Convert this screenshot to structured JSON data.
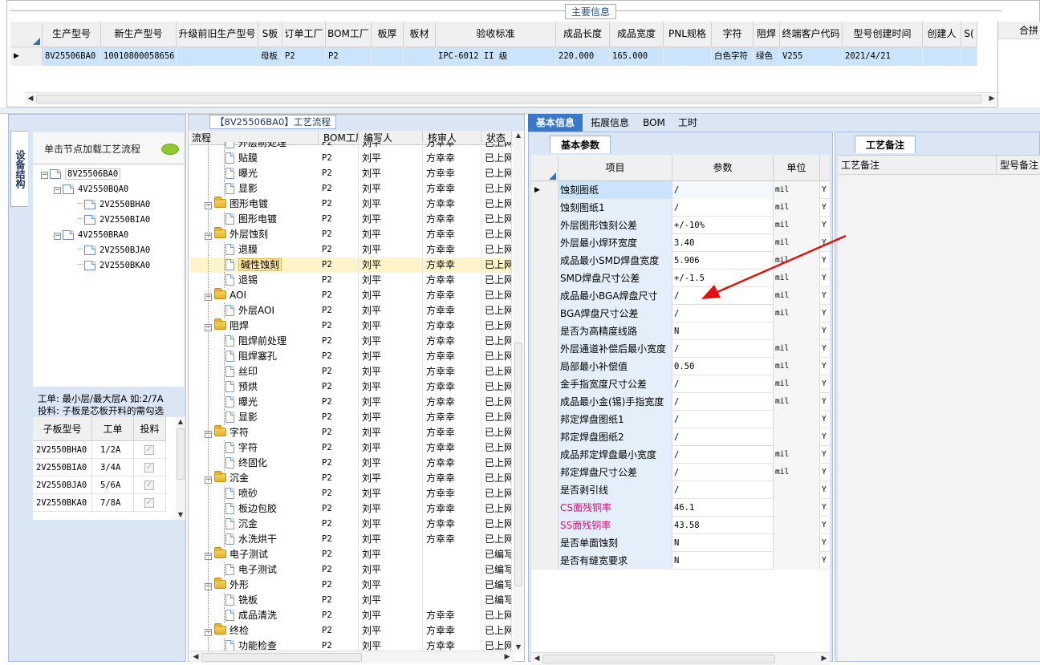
{
  "top": {
    "section_title": "主要信息",
    "columns": [
      "生产型号",
      "新生产型号",
      "升级前旧生产型号",
      "S板",
      "订单工厂",
      "BOM工厂",
      "板厚",
      "板材",
      "验收标准",
      "成品长度",
      "成品宽度",
      "PNL规格",
      "字符",
      "阻焊",
      "终端客户代码",
      "型号创建时间",
      "创建人",
      "S("
    ],
    "row": [
      "8V25506BA0",
      "10010800058656",
      "",
      "母板",
      "P2",
      "P2",
      "",
      "",
      "IPC-6012 II 级",
      "220.000",
      "165.000",
      "",
      "白色字符",
      "绿色",
      "V255",
      "2021/4/21",
      "",
      ""
    ],
    "right_header": "合拼"
  },
  "left": {
    "vtab": "设备结构",
    "header_text": "单击节点加载工艺流程",
    "tree": [
      {
        "label": "8V25506BA0",
        "level": 0
      },
      {
        "label": "4V2550BQA0",
        "level": 1
      },
      {
        "label": "2V2550BHA0",
        "level": 2
      },
      {
        "label": "2V2550BIA0",
        "level": 2
      },
      {
        "label": "4V2550BRA0",
        "level": 1
      },
      {
        "label": "2V2550BJA0",
        "level": 2
      },
      {
        "label": "2V2550BKA0",
        "level": 2
      }
    ],
    "note1": "工单: 最小层/最大层A 如:2/7A",
    "note2": "投料: 子板是芯板开料的需勾选",
    "table_headers": [
      "子板型号",
      "工单",
      "投料"
    ],
    "table_rows": [
      {
        "model": "2V2550BHA0",
        "order": "1/2A"
      },
      {
        "model": "2V2550BIA0",
        "order": "3/4A"
      },
      {
        "model": "2V2550BJA0",
        "order": "5/6A"
      },
      {
        "model": "2V2550BKA0",
        "order": "7/8A"
      }
    ]
  },
  "flow": {
    "title": "【8V25506BA0】工艺流程",
    "headers": [
      "流程",
      "BOM工厂",
      "编写人",
      "核审人",
      "状态"
    ],
    "rows": [
      {
        "t": "d",
        "name": "外层前处理",
        "bom": "P2",
        "w": "刘平",
        "r": "方幸幸",
        "s": "已上网"
      },
      {
        "t": "d",
        "name": "贴膜",
        "bom": "P2",
        "w": "刘平",
        "r": "方幸幸",
        "s": "已上网"
      },
      {
        "t": "d",
        "name": "曝光",
        "bom": "P2",
        "w": "刘平",
        "r": "方幸幸",
        "s": "已上网"
      },
      {
        "t": "d",
        "name": "显影",
        "bom": "P2",
        "w": "刘平",
        "r": "方幸幸",
        "s": "已上网"
      },
      {
        "t": "f",
        "name": "图形电镀",
        "bom": "P2",
        "w": "刘平",
        "r": "方幸幸",
        "s": "已上网"
      },
      {
        "t": "d",
        "name": "图形电镀",
        "bom": "P2",
        "w": "刘平",
        "r": "方幸幸",
        "s": "已上网"
      },
      {
        "t": "f",
        "name": "外层蚀刻",
        "bom": "P2",
        "w": "刘平",
        "r": "方幸幸",
        "s": "已上网"
      },
      {
        "t": "d",
        "name": "退膜",
        "bom": "P2",
        "w": "刘平",
        "r": "方幸幸",
        "s": "已上网"
      },
      {
        "t": "d",
        "name": "碱性蚀刻",
        "bom": "P2",
        "w": "刘平",
        "r": "方幸幸",
        "s": "已上网",
        "sel": true
      },
      {
        "t": "d",
        "name": "退锡",
        "bom": "P2",
        "w": "刘平",
        "r": "方幸幸",
        "s": "已上网"
      },
      {
        "t": "f",
        "name": "AOI",
        "bom": "P2",
        "w": "刘平",
        "r": "方幸幸",
        "s": "已上网"
      },
      {
        "t": "d",
        "name": "外层AOI",
        "bom": "P2",
        "w": "刘平",
        "r": "方幸幸",
        "s": "已上网"
      },
      {
        "t": "f",
        "name": "阻焊",
        "bom": "P2",
        "w": "刘平",
        "r": "方幸幸",
        "s": "已上网"
      },
      {
        "t": "d",
        "name": "阻焊前处理",
        "bom": "P2",
        "w": "刘平",
        "r": "方幸幸",
        "s": "已上网"
      },
      {
        "t": "d",
        "name": "阻焊塞孔",
        "bom": "P2",
        "w": "刘平",
        "r": "方幸幸",
        "s": "已上网"
      },
      {
        "t": "d",
        "name": "丝印",
        "bom": "P2",
        "w": "刘平",
        "r": "方幸幸",
        "s": "已上网"
      },
      {
        "t": "d",
        "name": "预烘",
        "bom": "P2",
        "w": "刘平",
        "r": "方幸幸",
        "s": "已上网"
      },
      {
        "t": "d",
        "name": "曝光",
        "bom": "P2",
        "w": "刘平",
        "r": "方幸幸",
        "s": "已上网"
      },
      {
        "t": "d",
        "name": "显影",
        "bom": "P2",
        "w": "刘平",
        "r": "方幸幸",
        "s": "已上网"
      },
      {
        "t": "f",
        "name": "字符",
        "bom": "P2",
        "w": "刘平",
        "r": "方幸幸",
        "s": "已上网"
      },
      {
        "t": "d",
        "name": "字符",
        "bom": "P2",
        "w": "刘平",
        "r": "方幸幸",
        "s": "已上网"
      },
      {
        "t": "d",
        "name": "终固化",
        "bom": "P2",
        "w": "刘平",
        "r": "方幸幸",
        "s": "已上网"
      },
      {
        "t": "f",
        "name": "沉金",
        "bom": "P2",
        "w": "刘平",
        "r": "方幸幸",
        "s": "已上网"
      },
      {
        "t": "d",
        "name": "喷砂",
        "bom": "P2",
        "w": "刘平",
        "r": "方幸幸",
        "s": "已上网"
      },
      {
        "t": "d",
        "name": "板边包胶",
        "bom": "P2",
        "w": "刘平",
        "r": "方幸幸",
        "s": "已上网"
      },
      {
        "t": "d",
        "name": "沉金",
        "bom": "P2",
        "w": "刘平",
        "r": "方幸幸",
        "s": "已上网"
      },
      {
        "t": "d",
        "name": "水洗烘干",
        "bom": "P2",
        "w": "刘平",
        "r": "方幸幸",
        "s": "已上网"
      },
      {
        "t": "f",
        "name": "电子测试",
        "bom": "P2",
        "w": "刘平",
        "r": "",
        "s": "已编写"
      },
      {
        "t": "d",
        "name": "电子测试",
        "bom": "P2",
        "w": "刘平",
        "r": "",
        "s": "已编写"
      },
      {
        "t": "f",
        "name": "外形",
        "bom": "P2",
        "w": "刘平",
        "r": "",
        "s": "已编写"
      },
      {
        "t": "d",
        "name": "铣板",
        "bom": "P2",
        "w": "刘平",
        "r": "",
        "s": "已编写"
      },
      {
        "t": "d",
        "name": "成品清洗",
        "bom": "P2",
        "w": "刘平",
        "r": "方幸幸",
        "s": "已上网"
      },
      {
        "t": "f",
        "name": "终检",
        "bom": "P2",
        "w": "刘平",
        "r": "方幸幸",
        "s": "已上网"
      },
      {
        "t": "d",
        "name": "功能检查",
        "bom": "P2",
        "w": "刘平",
        "r": "方幸幸",
        "s": "已上网"
      }
    ]
  },
  "right": {
    "tabs": [
      "基本信息",
      "拓展信息",
      "BOM",
      "工时"
    ],
    "subtab": "基本参数",
    "headers": [
      "项目",
      "参数",
      "单位"
    ],
    "rows": [
      {
        "item": "蚀刻图纸",
        "val": "/",
        "unit": "mil",
        "y": "Y"
      },
      {
        "item": "蚀刻图纸1",
        "val": "/",
        "unit": "mil",
        "y": "Y"
      },
      {
        "item": "外层图形蚀刻公差",
        "val": "+/-10%",
        "unit": "mil",
        "y": "Y"
      },
      {
        "item": "外层最小焊环宽度",
        "val": "3.40",
        "unit": "mil",
        "y": "Y"
      },
      {
        "item": "成品最小SMD焊盘宽度",
        "val": "5.906",
        "unit": "mil",
        "y": "Y"
      },
      {
        "item": "SMD焊盘尺寸公差",
        "val": "+/-1.5",
        "unit": "mil",
        "y": "Y"
      },
      {
        "item": "成品最小BGA焊盘尺寸",
        "val": "/",
        "unit": "mil",
        "y": "Y"
      },
      {
        "item": "BGA焊盘尺寸公差",
        "val": "/",
        "unit": "mil",
        "y": "Y"
      },
      {
        "item": "是否为高精度线路",
        "val": "N",
        "unit": "",
        "y": "Y"
      },
      {
        "item": "外层通道补偿后最小宽度",
        "val": "/",
        "unit": "mil",
        "y": "Y"
      },
      {
        "item": "局部最小补偿值",
        "val": "0.50",
        "unit": "mil",
        "y": "Y"
      },
      {
        "item": "金手指宽度尺寸公差",
        "val": "/",
        "unit": "mil",
        "y": "Y"
      },
      {
        "item": "成品最小金(锡)手指宽度",
        "val": "/",
        "unit": "mil",
        "y": "Y"
      },
      {
        "item": "邦定焊盘图纸1",
        "val": "/",
        "unit": "",
        "y": "Y"
      },
      {
        "item": "邦定焊盘图纸2",
        "val": "/",
        "unit": "",
        "y": "Y"
      },
      {
        "item": "成品邦定焊盘最小宽度",
        "val": "/",
        "unit": "mil",
        "y": "Y"
      },
      {
        "item": "邦定焊盘尺寸公差",
        "val": "/",
        "unit": "mil",
        "y": "Y"
      },
      {
        "item": "是否剥引线",
        "val": "/",
        "unit": "",
        "y": "Y"
      },
      {
        "item": "CS面残铜率",
        "val": "46.1",
        "unit": "",
        "y": "Y",
        "pink": true
      },
      {
        "item": "SS面残铜率",
        "val": "43.58",
        "unit": "",
        "y": "Y",
        "pink": true
      },
      {
        "item": "是否单面蚀刻",
        "val": "N",
        "unit": "",
        "y": "Y"
      },
      {
        "item": "是否有缝宽要求",
        "val": "N",
        "unit": "",
        "y": "Y"
      }
    ],
    "notes_tab": "工艺备注",
    "notes_headers": [
      "工艺备注",
      "型号备注"
    ]
  },
  "colors": {
    "accent": "#2f6fb6",
    "selection": "#cce4fb",
    "pink": "#c0187a",
    "arrow": "#e01010"
  }
}
